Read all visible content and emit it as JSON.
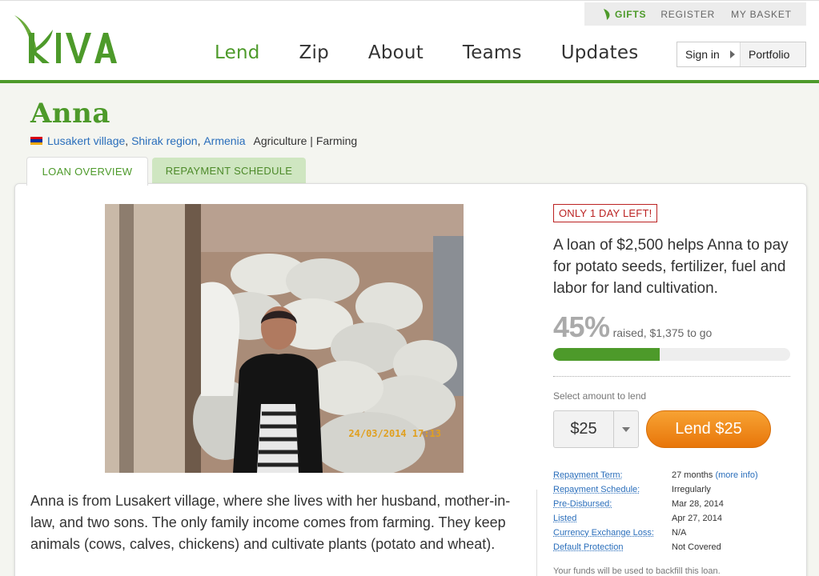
{
  "header": {
    "logo_text": "KIVA",
    "top_links": {
      "gifts": "GIFTS",
      "register": "REGISTER",
      "basket": "MY BASKET"
    },
    "nav": [
      "Lend",
      "Zip",
      "About",
      "Teams",
      "Updates"
    ],
    "active_nav": "Lend",
    "sign_in": "Sign in",
    "portfolio": "Portfolio"
  },
  "borrower": {
    "name": "Anna",
    "village": "Lusakert village",
    "region": "Shirak region",
    "country": "Armenia",
    "sector": "Agriculture | Farming"
  },
  "tabs": {
    "overview": "LOAN OVERVIEW",
    "repayment": "REPAYMENT SCHEDULE"
  },
  "photo": {
    "timestamp": "24/03/2014  17:13"
  },
  "story": "Anna is from Lusakert village, where she lives with her husband, mother-in-law, and two sons. The only family income comes from farming. They keep animals (cows, calves, chickens) and cultivate plants (potato and wheat).",
  "loan": {
    "days_left": "ONLY 1 DAY LEFT!",
    "use": "A loan of $2,500 helps Anna to pay for potato seeds, fertilizer, fuel and labor for land cultivation.",
    "percent": "45%",
    "percent_value": 0.45,
    "raised_text": "raised,",
    "to_go": "$1,375 to go",
    "select_label": "Select amount to lend",
    "amount": "$25",
    "lend_button": "Lend $25",
    "terms": [
      {
        "key": "Repayment Term:",
        "value": "27 months",
        "extra": "(more info)"
      },
      {
        "key": "Repayment Schedule:",
        "value": "Irregularly"
      },
      {
        "key": "Pre-Disbursed:",
        "value": "Mar 28, 2014"
      },
      {
        "key": "Listed",
        "value": "Apr 27, 2014"
      },
      {
        "key": "Currency Exchange Loss:",
        "value": "N/A"
      },
      {
        "key": "Default Protection",
        "value": "Not Covered"
      }
    ],
    "backfill_note": "Your funds will be used to backfill this loan."
  },
  "colors": {
    "brand_green": "#4d9a2a",
    "link_blue": "#2a6ebb",
    "lend_orange": "#f08c1a",
    "alert_red": "#b22222"
  }
}
